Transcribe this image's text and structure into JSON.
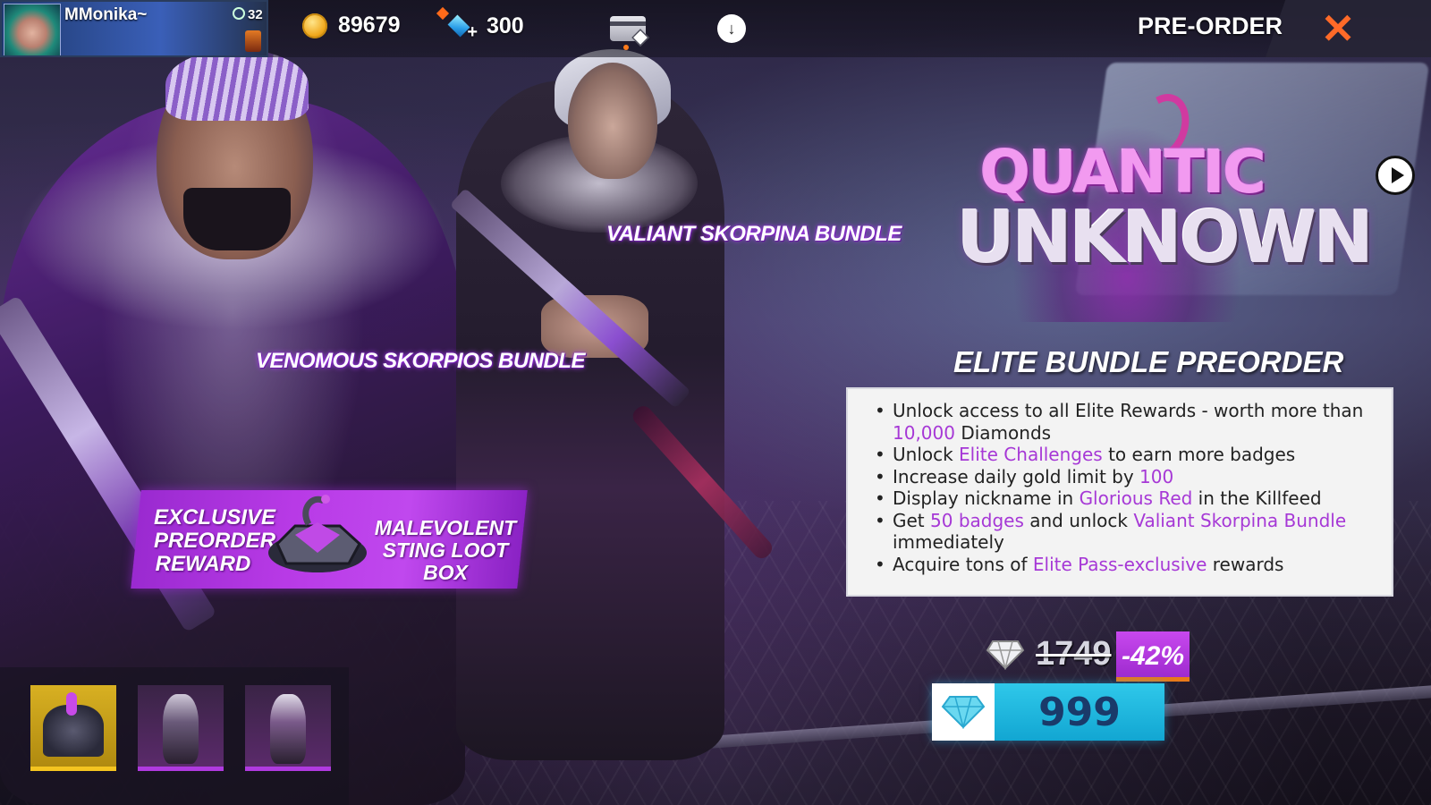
{
  "topbar": {
    "username": "MMonika~",
    "level": "32",
    "gold": "89679",
    "diamonds": "300",
    "preorder_label": "PRE-ORDER"
  },
  "art_labels": {
    "valiant": "VALIANT SKORPINA BUNDLE",
    "venomous": "VENOMOUS SKORPIOS BUNDLE"
  },
  "reward_banner": {
    "left_text": "EXCLUSIVE PREORDER REWARD",
    "right_text": "MALEVOLENT STING LOOT BOX"
  },
  "logo": {
    "line1": "QUANTIC",
    "line2": "UNKNOWN"
  },
  "elite": {
    "title": "ELITE BUNDLE PREORDER",
    "benefits": [
      {
        "parts": [
          [
            "Unlock access to all Elite Rewards - worth more than ",
            false
          ],
          [
            "10,000",
            true
          ],
          [
            " Diamonds",
            false
          ]
        ]
      },
      {
        "parts": [
          [
            "Unlock ",
            false
          ],
          [
            "Elite Challenges",
            true
          ],
          [
            " to earn more badges",
            false
          ]
        ]
      },
      {
        "parts": [
          [
            "Increase daily gold limit by ",
            false
          ],
          [
            "100",
            true
          ]
        ]
      },
      {
        "parts": [
          [
            "Display nickname in ",
            false
          ],
          [
            "Glorious Red",
            true
          ],
          [
            " in the Killfeed",
            false
          ]
        ]
      },
      {
        "parts": [
          [
            "Get ",
            false
          ],
          [
            "50 badges",
            true
          ],
          [
            " and unlock ",
            false
          ],
          [
            "Valiant Skorpina Bundle",
            true
          ],
          [
            " immediately",
            false
          ]
        ]
      },
      {
        "parts": [
          [
            "Acquire tons of ",
            false
          ],
          [
            "Elite Pass-exclusive",
            true
          ],
          [
            " rewards",
            false
          ]
        ]
      }
    ]
  },
  "price": {
    "old_price": "1749",
    "discount": "-42%",
    "new_price": "999"
  },
  "thumbnails": [
    {
      "name": "Malevolent Sting Loot Box",
      "selected": true
    },
    {
      "name": "Venomous Skorpios Bundle",
      "selected": false
    },
    {
      "name": "Valiant Skorpina Bundle",
      "selected": false
    }
  ],
  "colors": {
    "highlight": "#a638d6",
    "buy_button": "#1fb8e0",
    "discount_badge": "#b83ae0",
    "close_icon": "#ff6a28"
  },
  "icons": {
    "gold": "gold-coin-icon",
    "diamond": "diamond-icon",
    "card": "card-diamond-icon",
    "download": "download-cloud-icon",
    "close": "close-icon",
    "play": "play-icon"
  }
}
